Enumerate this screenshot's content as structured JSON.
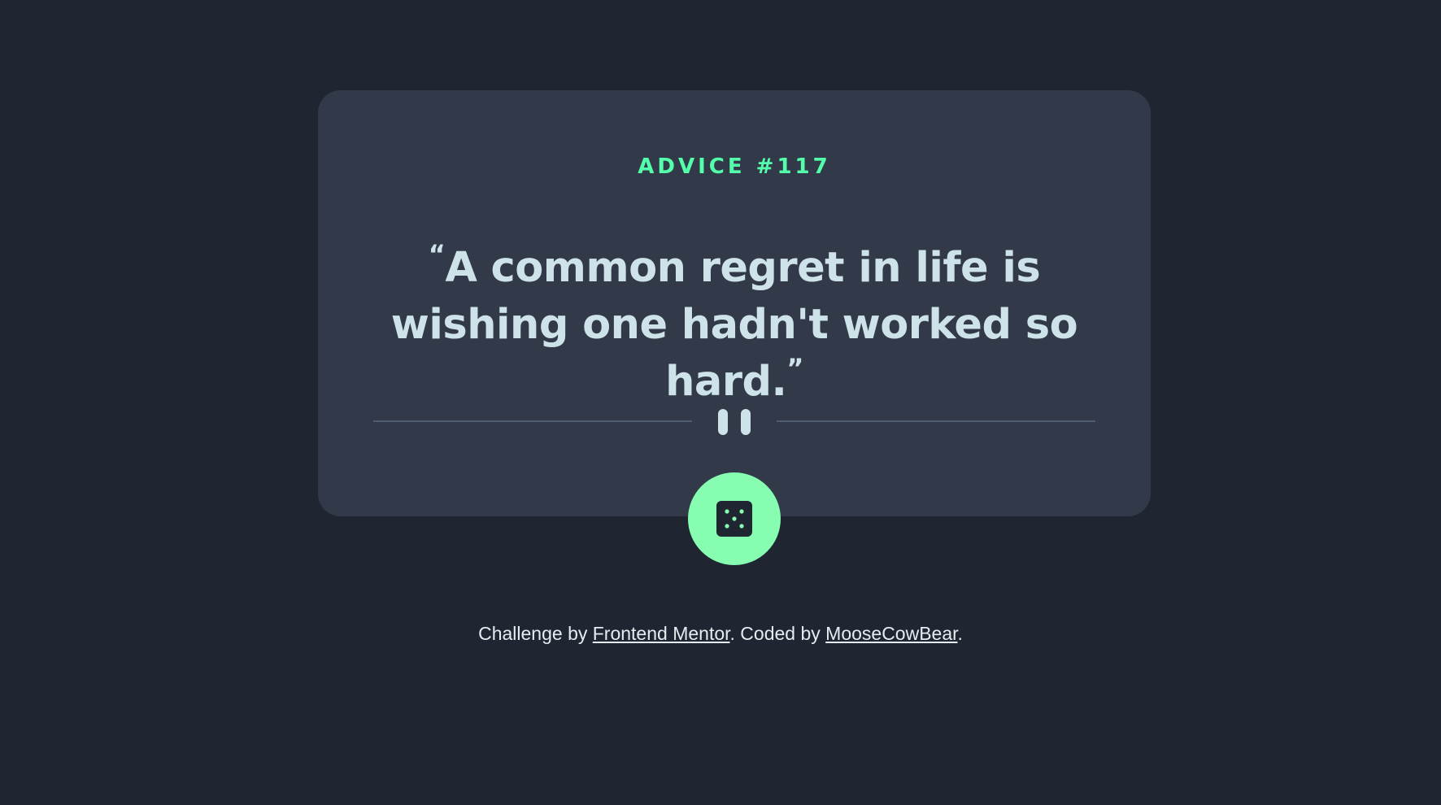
{
  "advice": {
    "id_label": "ADVICE #117",
    "open_quote": "“",
    "text": "A common regret in life is wishing one hadn't worked so hard.",
    "close_quote": "”"
  },
  "colors": {
    "background": "#1f2632",
    "card": "#323a49",
    "accent": "#53ffab",
    "text": "#cee3e9",
    "divider": "#4f5d74"
  },
  "icons": {
    "divider": "pause-icon",
    "button": "dice-icon"
  },
  "footer": {
    "prefix": "Challenge by ",
    "link1": "Frontend Mentor",
    "middle": ". Coded by ",
    "link2": "MooseCowBear",
    "suffix": "."
  }
}
